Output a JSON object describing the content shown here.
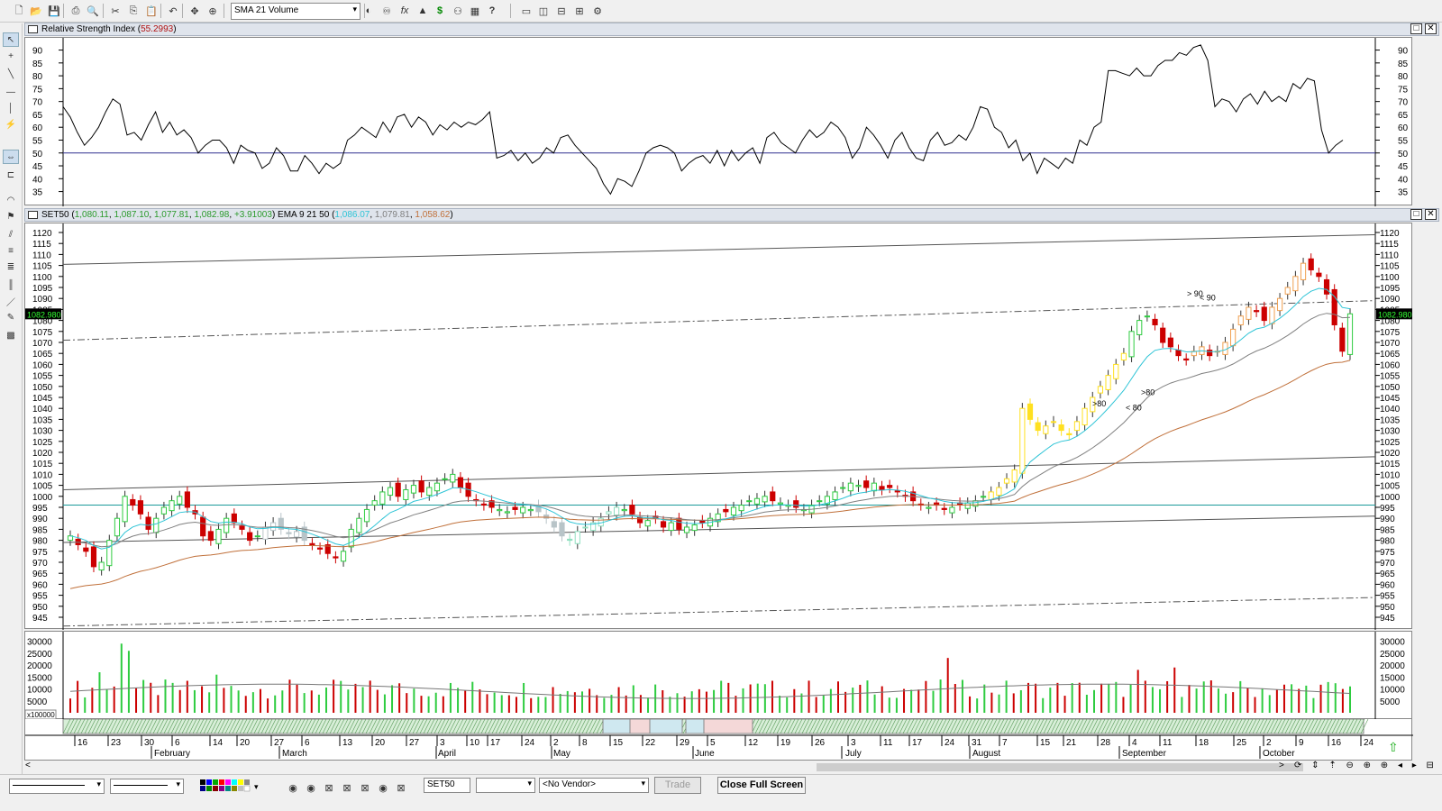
{
  "toolbar": {
    "indicator_select": "SMA 21 Volume",
    "icons": [
      "new-icon",
      "open-icon",
      "save-icon",
      "print-icon",
      "print-preview-icon",
      "cut-icon",
      "copy-icon",
      "paste-icon",
      "undo-icon",
      "pan-icon",
      "zoom-icon",
      "toggle-icon",
      "glasses-icon",
      "function-icon",
      "trend-icon",
      "dollar-icon",
      "binoculars-icon",
      "calendar-icon",
      "help-icon",
      "window-icon",
      "split-vertical-icon",
      "split-horizontal-icon",
      "tile-icon",
      "settings-icon"
    ]
  },
  "rsi_pane": {
    "title_prefix": "Relative Strength Index (",
    "value": "55.2993",
    "title_suffix": ")",
    "y_ticks": [
      "90",
      "85",
      "80",
      "75",
      "70",
      "65",
      "60",
      "55",
      "50",
      "45",
      "40",
      "35"
    ]
  },
  "price_pane": {
    "symbol": "SET50",
    "ohlc_open": "1,080.11",
    "ohlc_high": "1,087.10",
    "ohlc_low": "1,077.81",
    "ohlc_close": "1,082.98",
    "change": "+3.91003",
    "ema_label": "EMA 9 21 50 (",
    "ema9": "1,086.07",
    "ema21": "1,079.81",
    "ema50": "1,058.62",
    "close_paren": ")",
    "last_price": "1082.980",
    "y_ticks": [
      "1120",
      "1115",
      "1110",
      "1105",
      "1100",
      "1095",
      "1090",
      "1085",
      "1080",
      "1075",
      "1070",
      "1065",
      "1060",
      "1055",
      "1050",
      "1045",
      "1040",
      "1035",
      "1030",
      "1025",
      "1020",
      "1015",
      "1010",
      "1005",
      "1000",
      "995",
      "990",
      "985",
      "980",
      "975",
      "970",
      "965",
      "960",
      "955",
      "950",
      "945"
    ],
    "annotations": [
      ">80",
      "< 80",
      ">80",
      "> 90",
      "< 90"
    ]
  },
  "volume_pane": {
    "y_ticks": [
      "30000",
      "25000",
      "20000",
      "15000",
      "10000",
      "5000"
    ],
    "multiplier": "x100000"
  },
  "x_axis": {
    "days": [
      "16",
      "23",
      "30",
      "6",
      "14",
      "20",
      "27",
      "6",
      "13",
      "20",
      "27",
      "3",
      "10",
      "17",
      "24",
      "2",
      "8",
      "15",
      "22",
      "29",
      "5",
      "12",
      "19",
      "26",
      "3",
      "11",
      "17",
      "24",
      "31",
      "7",
      "15",
      "21",
      "28",
      "4",
      "11",
      "18",
      "25",
      "2",
      "9",
      "16",
      "24"
    ],
    "months": [
      "February",
      "March",
      "April",
      "May",
      "June",
      "July",
      "August",
      "September",
      "October"
    ]
  },
  "bottom": {
    "symbol_field": "SET50",
    "vendor_select": "<No Vendor>",
    "trade_button": "Trade",
    "close_full_screen": "Close Full Screen"
  },
  "colors": {
    "bull": "#2ecc40",
    "bear": "#cc0000",
    "ema9": "#2ec4d6",
    "ema21": "#808080",
    "ema50": "#c0703a",
    "yellow": "#ffe020",
    "orange": "#f0a050",
    "grey_candle": "#b8c4c8",
    "mint": "#90e0c0"
  }
}
